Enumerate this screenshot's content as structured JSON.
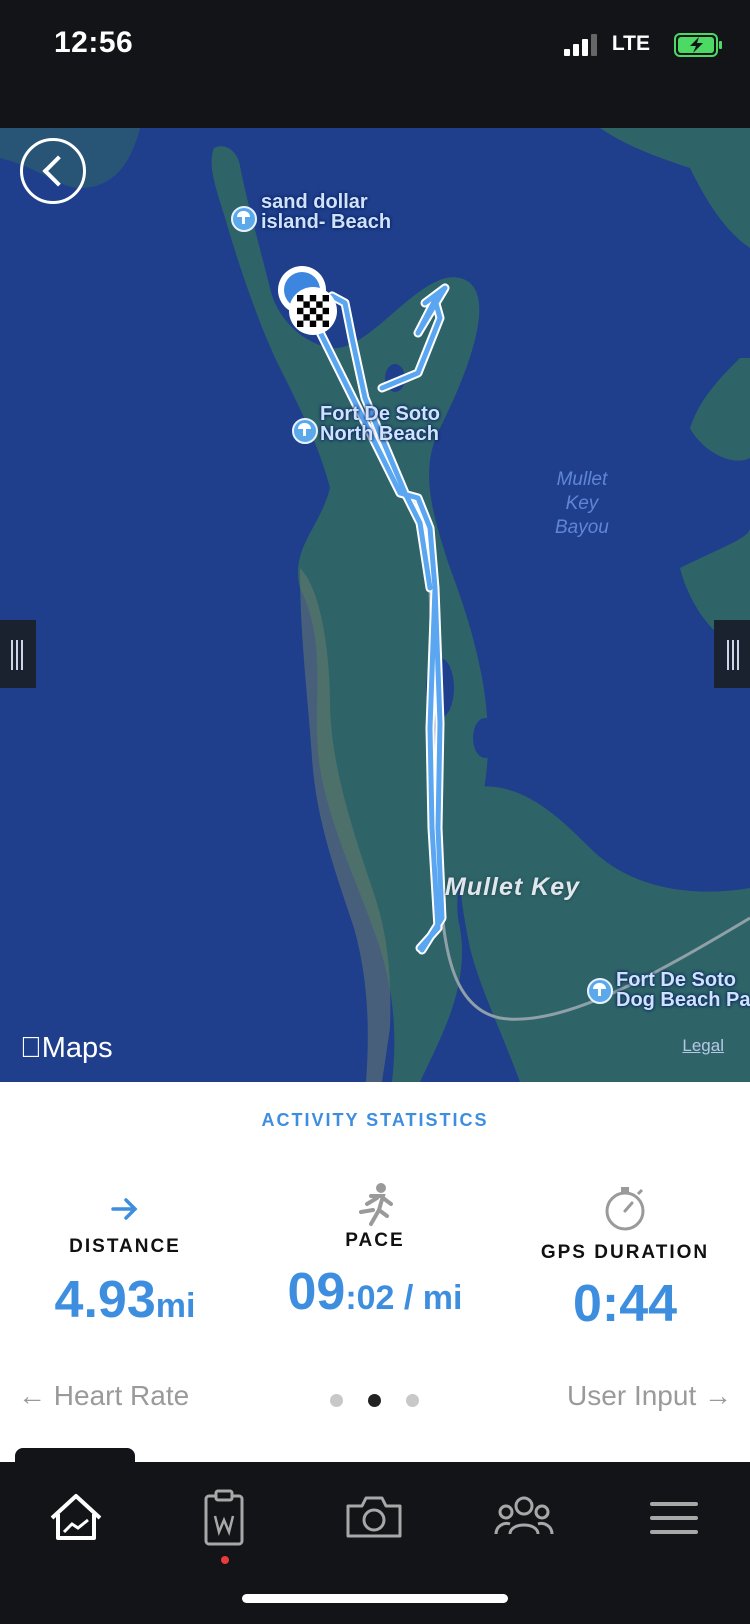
{
  "status_bar": {
    "time": "12:56",
    "network": "LTE",
    "battery_color": "#4cd964"
  },
  "map": {
    "labels": {
      "sand_dollar": [
        "sand dollar",
        "island- Beach"
      ],
      "fort_north": [
        "Fort De Soto",
        "North Beach"
      ],
      "bayou": [
        "Mullet",
        "Key",
        "Bayou"
      ],
      "mullet_key": "Mullet Key",
      "dog_beach": [
        "Fort De Soto",
        "Dog Beach Pa"
      ]
    },
    "brand": "Maps",
    "legal": "Legal",
    "route_color": "#5aa6f0"
  },
  "stats": {
    "title": "ACTIVITY STATISTICS",
    "distance": {
      "label": "DISTANCE",
      "value": "4.93",
      "unit": "mi",
      "icon": "arrow-right-icon"
    },
    "pace": {
      "label": "PACE",
      "value_main": "09",
      "value_rest": ":02 / mi",
      "icon": "runner-icon"
    },
    "gps_duration": {
      "label": "GPS DURATION",
      "value": "0:44",
      "icon": "stopwatch-icon"
    },
    "prev_link": "← Heart Rate",
    "next_link": "User Input →",
    "pagination": {
      "count": 3,
      "active_index": 1
    }
  },
  "tab_bar": {
    "tabs": [
      "home-icon",
      "clipboard-icon",
      "camera-icon",
      "community-icon",
      "menu-icon"
    ],
    "accent": "#e83b3b"
  }
}
